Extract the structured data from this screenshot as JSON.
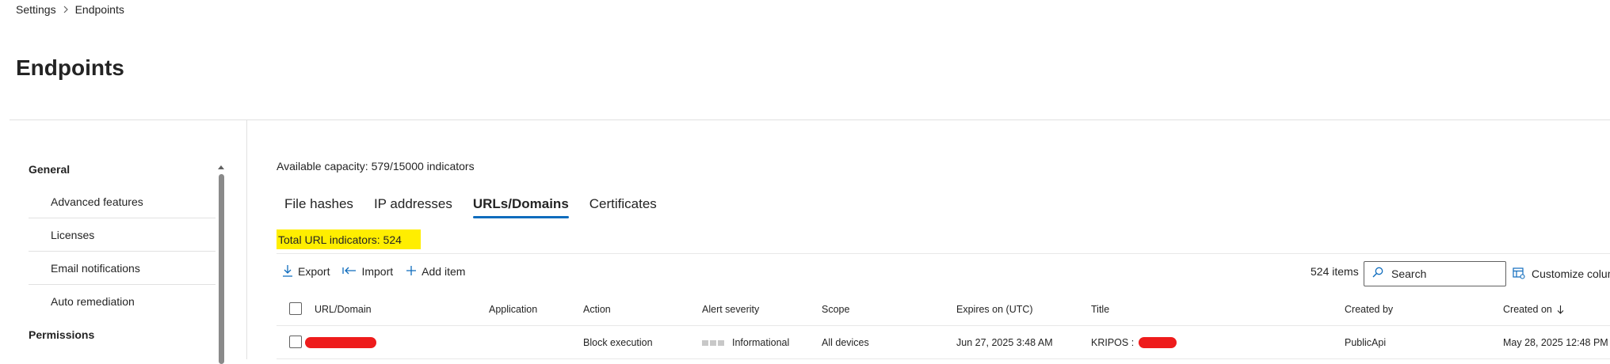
{
  "breadcrumb": {
    "items": [
      "Settings",
      "Endpoints"
    ]
  },
  "page": {
    "title": "Endpoints"
  },
  "sidebar": {
    "groups": [
      {
        "label": "General",
        "items": [
          {
            "label": "Advanced features"
          },
          {
            "label": "Licenses"
          },
          {
            "label": "Email notifications"
          },
          {
            "label": "Auto remediation"
          }
        ]
      },
      {
        "label": "Permissions",
        "items": []
      }
    ]
  },
  "main": {
    "capacity": "Available capacity: 579/15000 indicators",
    "tabs": [
      {
        "label": "File hashes",
        "active": false
      },
      {
        "label": "IP addresses",
        "active": false
      },
      {
        "label": "URLs/Domains",
        "active": true
      },
      {
        "label": "Certificates",
        "active": false
      }
    ],
    "total_indicators": "Total URL indicators: 524",
    "toolbar": {
      "export_label": "Export",
      "import_label": "Import",
      "add_label": "Add item"
    },
    "items_count": "524 items",
    "search": {
      "placeholder": "Search",
      "value": ""
    },
    "customize_label": "Customize columns",
    "table": {
      "columns": [
        "URL/Domain",
        "Application",
        "Action",
        "Alert severity",
        "Scope",
        "Expires on (UTC)",
        "Title",
        "Created by",
        "Created on"
      ],
      "sort_column": "Created on",
      "rows": [
        {
          "url": "",
          "application": "",
          "action": "Block execution",
          "severity": "Informational",
          "scope": "All devices",
          "expires": "Jun 27, 2025 3:48 AM",
          "title": "KRIPOS : ",
          "created_by": "PublicApi",
          "created_on": "May 28, 2025 12:48 PM"
        }
      ]
    }
  },
  "colors": {
    "accent": "#0f6cbd",
    "highlight": "#ffee00",
    "redaction": "#ee1c1c",
    "divider": "#e1e1e1"
  },
  "icons": {
    "breadcrumb_separator": "chevron-right-icon",
    "export": "arrow-download-icon",
    "import": "arrow-import-icon",
    "add": "plus-icon",
    "search": "search-icon",
    "customize": "table-settings-icon",
    "sort": "arrow-down-icon",
    "scroll_up": "caret-up-icon"
  }
}
